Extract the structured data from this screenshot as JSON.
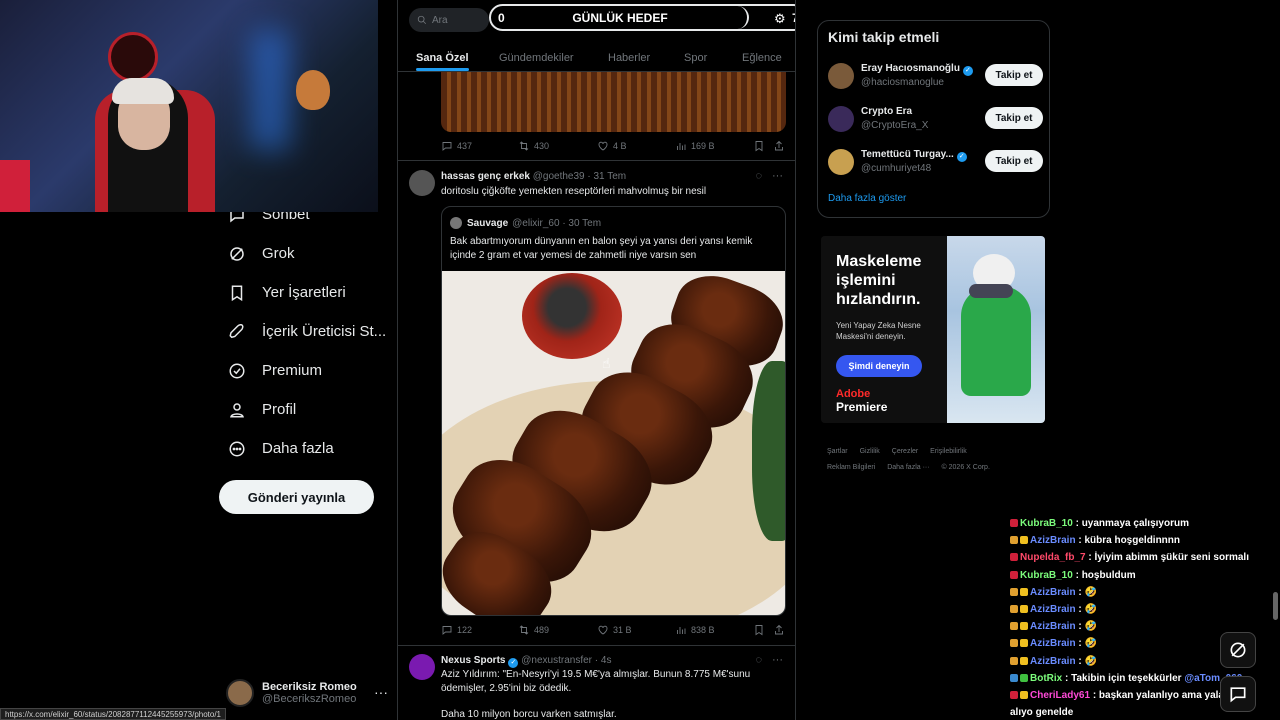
{
  "left_nav": {
    "items": [
      {
        "label": "Sohbet",
        "icon": "chat-icon"
      },
      {
        "label": "Grok",
        "icon": "grok-icon"
      },
      {
        "label": "Yer İşaretleri",
        "icon": "bookmark-icon"
      },
      {
        "label": "İçerik Üreticisi St...",
        "icon": "rocket-icon"
      },
      {
        "label": "Premium",
        "icon": "premium-icon"
      },
      {
        "label": "Profil",
        "icon": "person-icon"
      },
      {
        "label": "Daha fazla",
        "icon": "more-circle-icon"
      }
    ],
    "post_button": "Gönderi yayınla",
    "profile": {
      "name": "Beceriksiz Romeo",
      "handle": "@BecerikszRomeo"
    }
  },
  "status_url": "https://x.com/elixir_60/status/2082877112445255973/photo/1",
  "header": {
    "search_placeholder": "Ara",
    "goal": {
      "title": "GÜNLÜK HEDEF",
      "current": "0",
      "target": "7"
    },
    "tabs": [
      "Sana Özel",
      "Gündemdekiler",
      "Haberler",
      "Spor",
      "Eğlence"
    ]
  },
  "tweet0_stats": {
    "replies": "437",
    "reposts": "430",
    "likes": "4 B",
    "views": "169 B"
  },
  "tweet1": {
    "name": "hassas genç erkek",
    "handle": "@goethe39",
    "date": "· 31 Tem",
    "text": "doritoslu çiğköfte yemekten reseptörleri mahvolmuş bir nesil",
    "quote": {
      "name": "Sauvage",
      "handle": "@elixir_60",
      "date": "· 30 Tem",
      "text": "Bak abartmıyorum dünyanın en balon şeyi ya yansı deri yansı kemik içinde 2 gram et var yemesi de zahmetli niye varsın sen"
    },
    "stats": {
      "replies": "122",
      "reposts": "489",
      "likes": "31 B",
      "views": "838 B"
    }
  },
  "tweet2": {
    "name": "Nexus Sports",
    "handle": "@nexustransfer",
    "date": "· 4s",
    "text1": "Aziz Yıldırım: \"En-Nesyri'yi 19.5 M€'ya almışlar. Bunun 8.775 M€'sunu ödemişler, 2.95'ini biz ödedik.",
    "text2": "Daha 10 milyon borcu varken satmışlar."
  },
  "who_to_follow": {
    "title": "Kimi takip etmeli",
    "users": [
      {
        "name": "Eray Hacıosmanoğlu",
        "handle": "@haciosmanoglue",
        "verified": true,
        "button": "Takip et"
      },
      {
        "name": "Crypto Era",
        "handle": "@CryptoEra_X",
        "verified": false,
        "button": "Takip et"
      },
      {
        "name": "Temettücü Turgay...",
        "handle": "@cumhuriyet48",
        "verified": true,
        "button": "Takip et"
      }
    ],
    "show_more": "Daha fazla göster"
  },
  "ad": {
    "headline": "Maskeleme işlemini hızlandırın.",
    "sub": "Yeni Yapay Zeka Nesne Maskesi'ni deneyin.",
    "cta": "Şimdi deneyin",
    "brand_top": "Adobe",
    "brand": "Premiere"
  },
  "footer": {
    "row1": [
      "Şartlar",
      "Gizlilik",
      "Çerezler",
      "Erişilebilirlik"
    ],
    "row2": [
      "Reklam Bilgileri",
      "Daha fazla ···",
      "© 2026 X Corp."
    ]
  },
  "chat": [
    {
      "user": "KubraB_10",
      "color": "#7cfc7c",
      "msg": ": uyanmaya çalışıyorum"
    },
    {
      "user": "AzizBrain",
      "color": "#6a8cff",
      "msg": ": kübra hoşgeldinnnn"
    },
    {
      "user": "Nupelda_fb_7",
      "color": "#ff4a6a",
      "msg": ": İyiyim abimm şükür seni sormalı"
    },
    {
      "user": "KubraB_10",
      "color": "#7cfc7c",
      "msg": ": hoşbuldum"
    },
    {
      "user": "AzizBrain",
      "color": "#6a8cff",
      "msg": ": 🤣"
    },
    {
      "user": "AzizBrain",
      "color": "#6a8cff",
      "msg": ": 🤣"
    },
    {
      "user": "AzizBrain",
      "color": "#6a8cff",
      "msg": ": 🤣"
    },
    {
      "user": "AzizBrain",
      "color": "#6a8cff",
      "msg": ": 🤣"
    },
    {
      "user": "AzizBrain",
      "color": "#6a8cff",
      "msg": ": 🤣"
    },
    {
      "user": "BotRix",
      "color": "#7cfc7c",
      "msg": ": Takibin için teşekkürler",
      "mention": "@aTom_060"
    },
    {
      "user": "CheriLady61",
      "color": "#ff4ad8",
      "msg": ": başkan yalanlıyo ama yalanladığı"
    },
    {
      "user": "",
      "color": "#ffffff",
      "msg": "alıyo genelde"
    }
  ],
  "colors": {
    "accent": "#1d9bf0",
    "background": "#000000",
    "text": "#e7e9ea",
    "muted": "#71767b"
  }
}
